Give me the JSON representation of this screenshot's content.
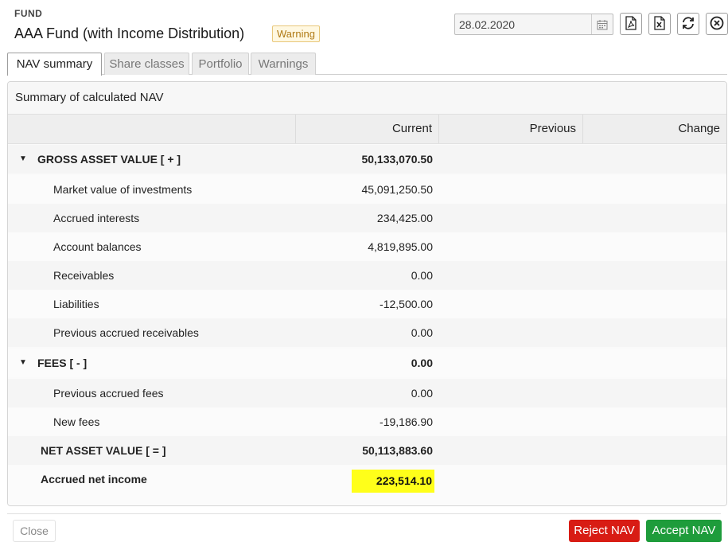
{
  "header": {
    "label": "FUND",
    "title": "AAA Fund (with Income Distribution)",
    "badge": "Warning"
  },
  "toolbar": {
    "date_value": "28.02.2020",
    "icons": [
      "calendar-icon",
      "pdf-icon",
      "excel-icon",
      "refresh-icon",
      "close-circle-icon"
    ]
  },
  "tabs": [
    "NAV summary",
    "Share classes",
    "Portfolio",
    "Warnings"
  ],
  "active_tab": "NAV summary",
  "panel": {
    "title": "Summary of calculated NAV",
    "columns": [
      "",
      "Current",
      "Previous",
      "Change"
    ],
    "rows": [
      {
        "label": "GROSS ASSET VALUE [ + ]",
        "current": "50,133,070.50",
        "type": "group"
      },
      {
        "label": "Market value of investments",
        "current": "45,091,250.50",
        "type": "item"
      },
      {
        "label": "Accrued interests",
        "current": "234,425.00",
        "type": "item"
      },
      {
        "label": "Account balances",
        "current": "4,819,895.00",
        "type": "item"
      },
      {
        "label": "Receivables",
        "current": "0.00",
        "type": "item"
      },
      {
        "label": "Liabilities",
        "current": "-12,500.00",
        "type": "item"
      },
      {
        "label": "Previous accrued receivables",
        "current": "0.00",
        "type": "item"
      },
      {
        "label": "FEES [ - ]",
        "current": "0.00",
        "type": "group"
      },
      {
        "label": "Previous accrued fees",
        "current": "0.00",
        "type": "item"
      },
      {
        "label": "New fees",
        "current": "-19,186.90",
        "type": "item"
      },
      {
        "label": "NET ASSET VALUE [ = ]",
        "current": "50,113,883.60",
        "type": "total"
      },
      {
        "label": "Accrued net income",
        "current": "223,514.10",
        "type": "total"
      }
    ]
  },
  "footer": {
    "close_label": "Close",
    "reject_label": "Reject NAV",
    "accept_label": "Accept NAV"
  },
  "colors": {
    "reject": "#d81c14",
    "accept": "#1e9c3b",
    "warning_text": "#b07a15",
    "highlight": "#ffff1a"
  }
}
